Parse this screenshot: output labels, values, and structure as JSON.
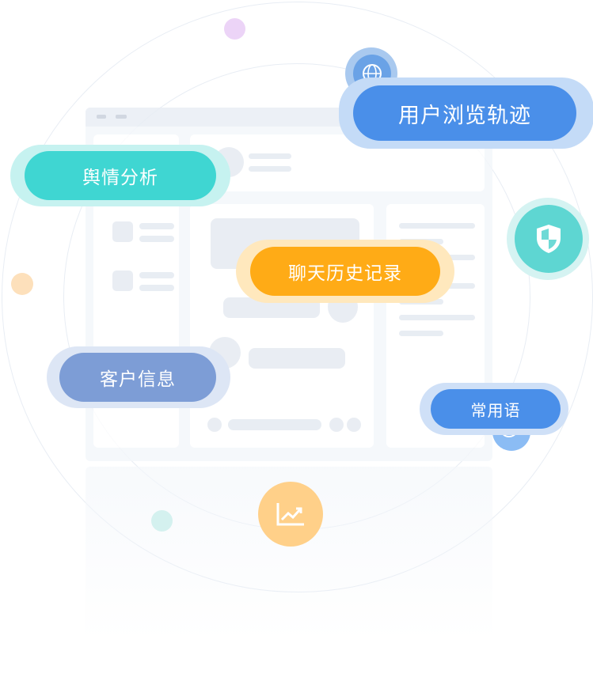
{
  "window": {
    "menu": [
      "",
      ""
    ]
  },
  "features": {
    "browse_track": "用户浏览轨迹",
    "sentiment": "舆情分析",
    "chat_history": "聊天历史记录",
    "customer_info": "客户信息",
    "common_phrases": "常用语"
  },
  "icons": {
    "globe": "globe-icon",
    "shield": "shield-icon",
    "chart": "trend-chart-icon"
  },
  "colors": {
    "blue": "#4a8fe9",
    "teal": "#3fd6d2",
    "orange": "#ffab16",
    "slate_blue": "#7d9dd6",
    "shield_teal": "#5ed6d2",
    "chart_orange": "#ffd089"
  }
}
